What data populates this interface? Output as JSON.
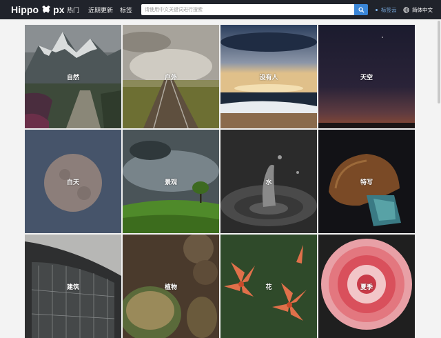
{
  "header": {
    "logo": {
      "left": "Hippo",
      "right": "px"
    },
    "nav": [
      {
        "label": "热门"
      },
      {
        "label": "近期更新"
      },
      {
        "label": "标签"
      }
    ],
    "search": {
      "placeholder": "请使用中文关键词进行搜索"
    },
    "tag_cloud": "标签云",
    "language": "简体中文"
  },
  "categories": [
    {
      "label": "自然"
    },
    {
      "label": "户外"
    },
    {
      "label": "没有人"
    },
    {
      "label": "天空"
    },
    {
      "label": "白天"
    },
    {
      "label": "景观"
    },
    {
      "label": "水"
    },
    {
      "label": "特写"
    },
    {
      "label": "建筑"
    },
    {
      "label": "植物"
    },
    {
      "label": "花"
    },
    {
      "label": "夏季"
    }
  ],
  "colors": {
    "topbar": "#20232b",
    "accent": "#3a86d8",
    "tag_cloud": "#7fb6ee",
    "page_bg": "#f3f3f3"
  }
}
